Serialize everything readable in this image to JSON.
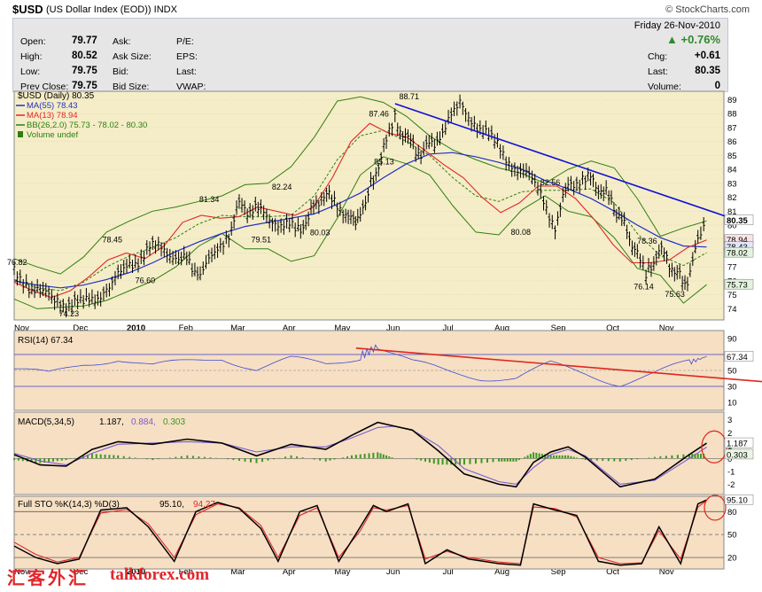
{
  "header": {
    "symbol": "$USD",
    "description": "(US Dollar Index (EOD))",
    "exchange": "INDX",
    "brand": "© StockCharts.com"
  },
  "quote": {
    "date": "Friday   26-Nov-2010",
    "pct_change": "+0.76%",
    "rows": [
      {
        "label": "Open:",
        "value": "79.77",
        "l2": "Ask:",
        "v2": "",
        "l3": "P/E:",
        "v3": ""
      },
      {
        "label": "High:",
        "value": "80.52",
        "l2": "Ask Size:",
        "v2": "",
        "l3": "EPS:",
        "v3": ""
      },
      {
        "label": "Low:",
        "value": "79.75",
        "l2": "Bid:",
        "v2": "",
        "l3": "Last:",
        "v3": ""
      },
      {
        "label": "Prev Close:",
        "value": "79.75",
        "l2": "Bid Size:",
        "v2": "",
        "l3": "VWAP:",
        "v3": ""
      }
    ],
    "right": [
      {
        "label": "Chg:",
        "value": "+0.61"
      },
      {
        "label": "Last:",
        "value": "80.35"
      },
      {
        "label": "Volume:",
        "value": "0"
      }
    ]
  },
  "legend": {
    "price": "$USD (Daily) 80.35",
    "ma55": "MA(55) 78.43",
    "ma13": "MA(13) 78.94",
    "bb": "BB(26,2.0) 75.73 - 78.02 - 80.30",
    "volume": "Volume undef"
  },
  "panels": {
    "rsi": {
      "label": "RSI(14) 67.34",
      "value": "67.34"
    },
    "macd": {
      "label_a": "MACD(5,34,5)",
      "label_b": "1.187,",
      "label_c": "0.884,",
      "label_d": "0.303",
      "value_a": "1.187",
      "value_b": "0.303"
    },
    "sto": {
      "label_a": "Full STO %K(14,3) %D(3)",
      "label_b": "95.10,",
      "label_c": "94.27",
      "value": "95.10"
    }
  },
  "watermark": {
    "cn": "汇客外汇",
    "en": "talkforex.com"
  },
  "colors": {
    "price_bg": "#f5edc7",
    "osc_bg": "#f6dfc3",
    "ma55": "#1f2fc8",
    "ma13": "#e3262a",
    "bb": "#2d7f12",
    "trend": "#1010d8",
    "rsi_trend": "#e0261e",
    "macd_hist": "#3a9a21"
  },
  "chart_data": {
    "type": "line",
    "x_labels": [
      "Nov",
      "Dec",
      "2010",
      "Feb",
      "Mar",
      "Apr",
      "May",
      "Jun",
      "Jul",
      "Aug",
      "Sep",
      "Oct",
      "Nov"
    ],
    "price": {
      "ylim": [
        73.2,
        89.6
      ],
      "y_ticks": [
        74,
        75,
        76,
        77,
        78,
        79,
        80,
        81,
        82,
        83,
        84,
        85,
        86,
        87,
        88,
        89
      ],
      "x": [
        0,
        14,
        30,
        50,
        80,
        110,
        130,
        160,
        190,
        215,
        235,
        245,
        260,
        285,
        305,
        328,
        340,
        355,
        370,
        380,
        392,
        397,
        406,
        412,
        421,
        430,
        440,
        455,
        470,
        495,
        515,
        535,
        555,
        575,
        595,
        605,
        625,
        640,
        660,
        675,
        690,
        705,
        720,
        730,
        745,
        760,
        775,
        790,
        800
      ],
      "close": [
        76.82,
        75.8,
        75.1,
        74.6,
        74.23,
        75.6,
        76.9,
        78.45,
        77.8,
        76.6,
        78.0,
        79.0,
        81.34,
        80.9,
        80.3,
        79.51,
        80.6,
        82.24,
        81.8,
        81.2,
        80.03,
        80.8,
        81.2,
        82.9,
        84.5,
        85.9,
        87.46,
        86.1,
        85.13,
        86.6,
        88.71,
        87.2,
        85.8,
        84.5,
        83.4,
        82.3,
        80.08,
        82.9,
        83.56,
        82.8,
        81.7,
        79.8,
        78.0,
        76.14,
        78.36,
        77.1,
        75.63,
        78.6,
        80.35
      ],
      "ma13": [
        75.9,
        75.3,
        74.8,
        75.3,
        76.3,
        77.5,
        78.0,
        77.6,
        78.5,
        80.2,
        80.7,
        80.5,
        80.6,
        81.3,
        81.0,
        80.7,
        81.3,
        83.4,
        86.0,
        87.3,
        86.6,
        86.3,
        85.3,
        84.3,
        83.4,
        82.0,
        80.9,
        81.6,
        82.8,
        82.8,
        81.9,
        80.4,
        78.6,
        77.3,
        77.3,
        77.5,
        78.4,
        78.94
      ],
      "ma55": [
        76.0,
        75.7,
        75.5,
        75.7,
        76.1,
        76.6,
        77.3,
        78.1,
        78.8,
        79.4,
        79.9,
        80.2,
        80.5,
        80.8,
        81.5,
        82.3,
        83.4,
        84.4,
        85.1,
        85.2,
        84.9,
        84.5,
        84.0,
        83.2,
        82.6,
        81.9,
        81.0,
        80.0,
        79.1,
        78.5,
        78.43
      ],
      "bb_upper": [
        77.6,
        77.0,
        76.5,
        77.7,
        79.5,
        80.3,
        81.0,
        81.3,
        81.7,
        82.1,
        82.9,
        83.0,
        84.2,
        86.3,
        88.9,
        89.2,
        88.8,
        87.8,
        86.4,
        85.4,
        84.7,
        84.1,
        83.7,
        83.0,
        84.0,
        84.6,
        84.1,
        81.9,
        79.2,
        79.8,
        80.3
      ],
      "bb_mid": [
        76.1,
        75.5,
        75.3,
        75.9,
        77.0,
        77.8,
        78.4,
        79.1,
        80.1,
        80.7,
        80.6,
        80.6,
        80.7,
        82.1,
        84.7,
        86.4,
        86.8,
        86.0,
        85.0,
        83.4,
        82.1,
        81.7,
        82.4,
        82.5,
        82.5,
        82.6,
        81.6,
        79.4,
        77.8,
        77.1,
        78.02
      ],
      "bb_lower": [
        74.7,
        74.0,
        74.1,
        74.2,
        74.6,
        75.3,
        76.0,
        77.0,
        78.5,
        79.4,
        78.3,
        78.3,
        77.4,
        77.8,
        80.5,
        83.6,
        84.9,
        84.4,
        83.6,
        81.4,
        79.5,
        79.3,
        81.1,
        82.1,
        81.0,
        80.6,
        79.1,
        76.9,
        76.4,
        74.4,
        75.73
      ],
      "trendline": [
        [
          440,
          88.71
        ],
        [
          820,
          79.5
        ]
      ],
      "annotations": [
        [
          "76.82",
          0,
          76.82
        ],
        [
          "74.23",
          60,
          74.23
        ],
        [
          "78.45",
          110,
          78.45
        ],
        [
          "76.60",
          148,
          76.6
        ],
        [
          "81.34",
          222,
          81.34
        ],
        [
          "79.51",
          282,
          79.51
        ],
        [
          "82.24",
          306,
          82.24
        ],
        [
          "80.03",
          350,
          80.03
        ],
        [
          "87.46",
          418,
          87.46
        ],
        [
          "85.13",
          424,
          85.13
        ],
        [
          "88.71",
          453,
          88.71
        ],
        [
          "80.08",
          582,
          80.08
        ],
        [
          "82.56",
          616,
          82.56
        ],
        [
          "78.36",
          728,
          78.36
        ],
        [
          "76.14",
          724,
          76.14
        ],
        [
          "75.63",
          760,
          75.63
        ]
      ],
      "right_tags": [
        [
          "80.35",
          80.35
        ],
        [
          "78.94",
          78.94
        ],
        [
          "78.43",
          78.43
        ],
        [
          "78.02",
          78.02
        ],
        [
          "75.73",
          75.73
        ]
      ]
    },
    "rsi": {
      "ylim": [
        0,
        100
      ],
      "y_ticks": [
        10,
        30,
        50,
        70,
        90
      ],
      "lines": [
        30,
        50,
        70
      ],
      "x": [
        0,
        40,
        80,
        120,
        160,
        200,
        240,
        280,
        320,
        360,
        400,
        420,
        460,
        500,
        540,
        580,
        620,
        660,
        700,
        740,
        780,
        800
      ],
      "values": [
        52,
        44,
        58,
        66,
        55,
        60,
        67,
        52,
        63,
        58,
        68,
        80,
        59,
        49,
        42,
        40,
        57,
        47,
        34,
        45,
        60,
        67.34
      ],
      "trendline": [
        [
          395,
          78
        ],
        [
          860,
          36
        ]
      ]
    },
    "macd": {
      "ylim": [
        -2.8,
        3.6
      ],
      "y_ticks": [
        -2,
        -1,
        0,
        1,
        2,
        3
      ],
      "x": [
        0,
        30,
        60,
        90,
        120,
        160,
        200,
        240,
        280,
        320,
        360,
        390,
        420,
        440,
        460,
        490,
        520,
        560,
        580,
        600,
        620,
        640,
        660,
        700,
        740,
        780,
        800
      ],
      "macd": [
        0.3,
        -0.5,
        -0.6,
        0.7,
        1.3,
        1.1,
        1.5,
        1.2,
        0.2,
        1.1,
        0.7,
        1.8,
        2.8,
        2.5,
        2.2,
        0.6,
        -1.2,
        -2.0,
        -2.2,
        -0.3,
        0.5,
        0.9,
        0.1,
        -2.2,
        -1.6,
        0.3,
        1.187
      ],
      "signal": [
        0.4,
        -0.2,
        -0.5,
        0.4,
        1.1,
        1.2,
        1.3,
        1.2,
        0.5,
        0.9,
        0.9,
        1.6,
        2.4,
        2.5,
        2.2,
        1.0,
        -0.8,
        -1.8,
        -2.0,
        -0.7,
        0.3,
        0.7,
        0.2,
        -2.0,
        -1.7,
        0.0,
        0.884
      ]
    },
    "sto": {
      "ylim": [
        5,
        100
      ],
      "y_ticks": [
        20,
        50,
        80
      ],
      "lines": [
        20,
        50,
        80
      ],
      "x": [
        0,
        25,
        50,
        75,
        100,
        130,
        155,
        185,
        210,
        235,
        260,
        285,
        305,
        330,
        350,
        375,
        400,
        415,
        430,
        455,
        475,
        500,
        525,
        560,
        585,
        600,
        625,
        650,
        675,
        700,
        725,
        745,
        770,
        790,
        800
      ],
      "k": [
        35,
        20,
        12,
        18,
        82,
        85,
        60,
        15,
        80,
        92,
        84,
        58,
        15,
        80,
        88,
        15,
        60,
        88,
        80,
        90,
        12,
        30,
        18,
        12,
        10,
        90,
        82,
        75,
        15,
        10,
        12,
        60,
        12,
        90,
        95.1
      ],
      "d": [
        40,
        24,
        14,
        20,
        78,
        83,
        64,
        20,
        76,
        90,
        85,
        62,
        20,
        75,
        85,
        20,
        55,
        85,
        82,
        88,
        18,
        28,
        20,
        14,
        12,
        86,
        84,
        73,
        20,
        12,
        13,
        55,
        18,
        86,
        94.27
      ]
    }
  }
}
